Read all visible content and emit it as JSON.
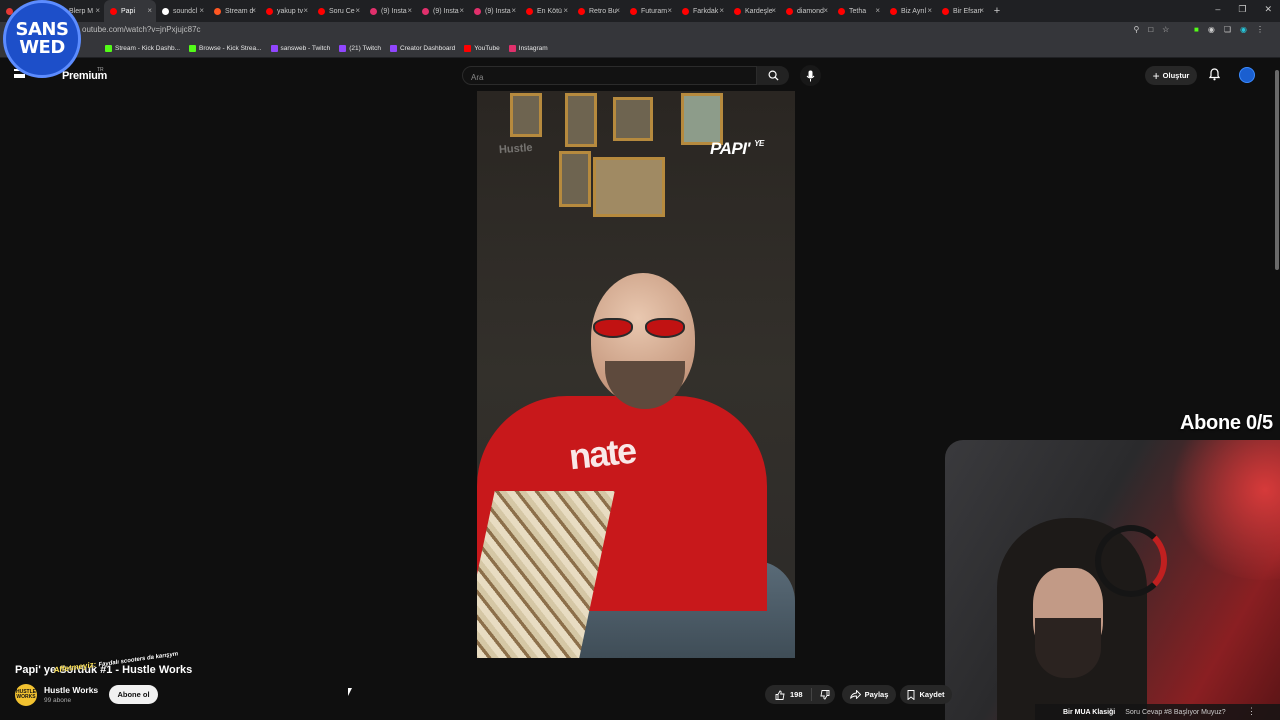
{
  "browser": {
    "tabs": [
      {
        "label": "",
        "color": "#e53935",
        "active": false
      },
      {
        "label": "Blerp M",
        "color": "#9c27b0",
        "active": false
      },
      {
        "label": "Papi",
        "color": "#ff0000",
        "active": true
      },
      {
        "label": "soundcl",
        "color": "#ffffff",
        "active": false
      },
      {
        "label": "Stream d",
        "color": "#ff5722",
        "active": false
      },
      {
        "label": "yakup tv",
        "color": "#ff0000",
        "active": false
      },
      {
        "label": "Soru Ce",
        "color": "#ff0000",
        "active": false
      },
      {
        "label": "(9) Insta",
        "color": "#e1306c",
        "active": false
      },
      {
        "label": "(9) Insta",
        "color": "#e1306c",
        "active": false
      },
      {
        "label": "(9) Insta",
        "color": "#e1306c",
        "active": false
      },
      {
        "label": "En Kötü",
        "color": "#ff0000",
        "active": false
      },
      {
        "label": "Retro Bu",
        "color": "#ff0000",
        "active": false
      },
      {
        "label": "Futuram",
        "color": "#ff0000",
        "active": false
      },
      {
        "label": "Farkdak",
        "color": "#ff0000",
        "active": false
      },
      {
        "label": "Kardeşle",
        "color": "#ff0000",
        "active": false
      },
      {
        "label": "diamond",
        "color": "#ff0000",
        "active": false
      },
      {
        "label": "Tetha",
        "color": "#ff0000",
        "active": false
      },
      {
        "label": "Biz Ayrıl",
        "color": "#ff0000",
        "active": false
      },
      {
        "label": "Bir Efsan",
        "color": "#ff0000",
        "active": false
      }
    ],
    "url": "outube.com/watch?v=jnPxjujc87c",
    "bookmarks": [
      {
        "label": "Stream - Kick Dashb...",
        "color": "#53fc18"
      },
      {
        "label": "Browse - Kick Strea...",
        "color": "#53fc18"
      },
      {
        "label": "sansweb - Twitch",
        "color": "#9146ff"
      },
      {
        "label": "(21) Twitch",
        "color": "#9146ff"
      },
      {
        "label": "Creator Dashboard",
        "color": "#9146ff"
      },
      {
        "label": "YouTube",
        "color": "#ff0000"
      },
      {
        "label": "Instagram",
        "color": "#e1306c"
      }
    ]
  },
  "youtube": {
    "brand": "Premium",
    "brand_sup": "TR",
    "search_placeholder": "Ara",
    "create_label": "Oluştur",
    "video_overlay_title": "PAPI",
    "video_overlay_suffix": "YE",
    "video_title": "Papi' ye Sorduk #1 - Hustle Works",
    "channel": {
      "name": "Hustle Works",
      "subs": "99 abone",
      "avatar_text": "HUSTLE WORKS"
    },
    "subscribe_label": "Abone ol",
    "likes": "198",
    "share_label": "Paylaş",
    "save_label": "Kaydet"
  },
  "overlay": {
    "logo_line1": "SANS",
    "logo_line2": "WED",
    "sub_counter": "Abone 0/5",
    "donation_name": "Affetmeyiz",
    "donation_text": "Faydalı scooters da karışym",
    "ticker_title": "Bir MUA Klasiği",
    "ticker_next": "Soru Cevap #8 Başlıyor Muyuz?"
  }
}
